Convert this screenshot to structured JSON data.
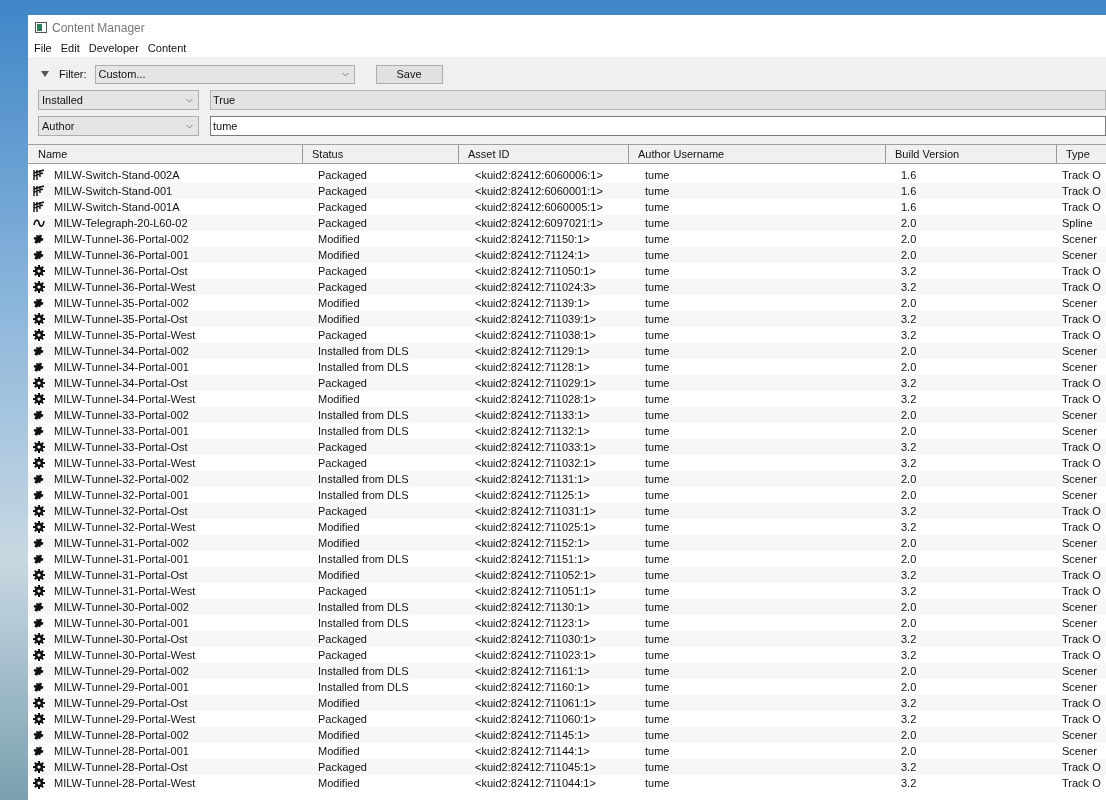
{
  "window": {
    "title": "Content Manager"
  },
  "menu": [
    "File",
    "Edit",
    "Developer",
    "Content"
  ],
  "filter": {
    "label": "Filter:",
    "preset": "Custom...",
    "save_button": "Save"
  },
  "conditions": [
    {
      "field": "Installed",
      "value": "True",
      "editable": false
    },
    {
      "field": "Author",
      "value": "tume",
      "editable": true
    }
  ],
  "table": {
    "columns": [
      "Name",
      "Status",
      "Asset ID",
      "Author Username",
      "Build Version",
      "Type"
    ],
    "rows": [
      {
        "kind": "switch",
        "name": "MILW-Switch-Stand-002A",
        "status": "Packaged",
        "asset_id": "<kuid2:82412:6060006:1>",
        "author": "tume",
        "build": "1.6",
        "type": "Track O"
      },
      {
        "kind": "switch",
        "name": "MILW-Switch-Stand-001",
        "status": "Packaged",
        "asset_id": "<kuid2:82412:6060001:1>",
        "author": "tume",
        "build": "1.6",
        "type": "Track O"
      },
      {
        "kind": "switch",
        "name": "MILW-Switch-Stand-001A",
        "status": "Packaged",
        "asset_id": "<kuid2:82412:6060005:1>",
        "author": "tume",
        "build": "1.6",
        "type": "Track O"
      },
      {
        "kind": "spline",
        "name": "MILW-Telegraph-20-L60-02",
        "status": "Packaged",
        "asset_id": "<kuid2:82412:6097021:1>",
        "author": "tume",
        "build": "2.0",
        "type": "Spline"
      },
      {
        "kind": "scenery",
        "name": "MILW-Tunnel-36-Portal-002",
        "status": "Modified",
        "asset_id": "<kuid2:82412:71150:1>",
        "author": "tume",
        "build": "2.0",
        "type": "Scener"
      },
      {
        "kind": "scenery",
        "name": "MILW-Tunnel-36-Portal-001",
        "status": "Modified",
        "asset_id": "<kuid2:82412:71124:1>",
        "author": "tume",
        "build": "2.0",
        "type": "Scener"
      },
      {
        "kind": "track",
        "name": "MILW-Tunnel-36-Portal-Ost",
        "status": "Packaged",
        "asset_id": "<kuid2:82412:711050:1>",
        "author": "tume",
        "build": "3.2",
        "type": "Track O"
      },
      {
        "kind": "track",
        "name": "MILW-Tunnel-36-Portal-West",
        "status": "Packaged",
        "asset_id": "<kuid2:82412:711024:3>",
        "author": "tume",
        "build": "3.2",
        "type": "Track O"
      },
      {
        "kind": "scenery",
        "name": "MILW-Tunnel-35-Portal-002",
        "status": "Modified",
        "asset_id": "<kuid2:82412:71139:1>",
        "author": "tume",
        "build": "2.0",
        "type": "Scener"
      },
      {
        "kind": "track",
        "name": "MILW-Tunnel-35-Portal-Ost",
        "status": "Modified",
        "asset_id": "<kuid2:82412:711039:1>",
        "author": "tume",
        "build": "3.2",
        "type": "Track O"
      },
      {
        "kind": "track",
        "name": "MILW-Tunnel-35-Portal-West",
        "status": "Packaged",
        "asset_id": "<kuid2:82412:711038:1>",
        "author": "tume",
        "build": "3.2",
        "type": "Track O"
      },
      {
        "kind": "scenery",
        "name": "MILW-Tunnel-34-Portal-002",
        "status": "Installed from DLS",
        "asset_id": "<kuid2:82412:71129:1>",
        "author": "tume",
        "build": "2.0",
        "type": "Scener"
      },
      {
        "kind": "scenery",
        "name": "MILW-Tunnel-34-Portal-001",
        "status": "Installed from DLS",
        "asset_id": "<kuid2:82412:71128:1>",
        "author": "tume",
        "build": "2.0",
        "type": "Scener"
      },
      {
        "kind": "track",
        "name": "MILW-Tunnel-34-Portal-Ost",
        "status": "Packaged",
        "asset_id": "<kuid2:82412:711029:1>",
        "author": "tume",
        "build": "3.2",
        "type": "Track O"
      },
      {
        "kind": "track",
        "name": "MILW-Tunnel-34-Portal-West",
        "status": "Modified",
        "asset_id": "<kuid2:82412:711028:1>",
        "author": "tume",
        "build": "3.2",
        "type": "Track O"
      },
      {
        "kind": "scenery",
        "name": "MILW-Tunnel-33-Portal-002",
        "status": "Installed from DLS",
        "asset_id": "<kuid2:82412:71133:1>",
        "author": "tume",
        "build": "2.0",
        "type": "Scener"
      },
      {
        "kind": "scenery",
        "name": "MILW-Tunnel-33-Portal-001",
        "status": "Installed from DLS",
        "asset_id": "<kuid2:82412:71132:1>",
        "author": "tume",
        "build": "2.0",
        "type": "Scener"
      },
      {
        "kind": "track",
        "name": "MILW-Tunnel-33-Portal-Ost",
        "status": "Packaged",
        "asset_id": "<kuid2:82412:711033:1>",
        "author": "tume",
        "build": "3.2",
        "type": "Track O"
      },
      {
        "kind": "track",
        "name": "MILW-Tunnel-33-Portal-West",
        "status": "Packaged",
        "asset_id": "<kuid2:82412:711032:1>",
        "author": "tume",
        "build": "3.2",
        "type": "Track O"
      },
      {
        "kind": "scenery",
        "name": "MILW-Tunnel-32-Portal-002",
        "status": "Installed from DLS",
        "asset_id": "<kuid2:82412:71131:1>",
        "author": "tume",
        "build": "2.0",
        "type": "Scener"
      },
      {
        "kind": "scenery",
        "name": "MILW-Tunnel-32-Portal-001",
        "status": "Installed from DLS",
        "asset_id": "<kuid2:82412:71125:1>",
        "author": "tume",
        "build": "2.0",
        "type": "Scener"
      },
      {
        "kind": "track",
        "name": "MILW-Tunnel-32-Portal-Ost",
        "status": "Packaged",
        "asset_id": "<kuid2:82412:711031:1>",
        "author": "tume",
        "build": "3.2",
        "type": "Track O"
      },
      {
        "kind": "track",
        "name": "MILW-Tunnel-32-Portal-West",
        "status": "Modified",
        "asset_id": "<kuid2:82412:711025:1>",
        "author": "tume",
        "build": "3.2",
        "type": "Track O"
      },
      {
        "kind": "scenery",
        "name": "MILW-Tunnel-31-Portal-002",
        "status": "Modified",
        "asset_id": "<kuid2:82412:71152:1>",
        "author": "tume",
        "build": "2.0",
        "type": "Scener"
      },
      {
        "kind": "scenery",
        "name": "MILW-Tunnel-31-Portal-001",
        "status": "Installed from DLS",
        "asset_id": "<kuid2:82412:71151:1>",
        "author": "tume",
        "build": "2.0",
        "type": "Scener"
      },
      {
        "kind": "track",
        "name": "MILW-Tunnel-31-Portal-Ost",
        "status": "Modified",
        "asset_id": "<kuid2:82412:711052:1>",
        "author": "tume",
        "build": "3.2",
        "type": "Track O"
      },
      {
        "kind": "track",
        "name": "MILW-Tunnel-31-Portal-West",
        "status": "Packaged",
        "asset_id": "<kuid2:82412:711051:1>",
        "author": "tume",
        "build": "3.2",
        "type": "Track O"
      },
      {
        "kind": "scenery",
        "name": "MILW-Tunnel-30-Portal-002",
        "status": "Installed from DLS",
        "asset_id": "<kuid2:82412:71130:1>",
        "author": "tume",
        "build": "2.0",
        "type": "Scener"
      },
      {
        "kind": "scenery",
        "name": "MILW-Tunnel-30-Portal-001",
        "status": "Installed from DLS",
        "asset_id": "<kuid2:82412:71123:1>",
        "author": "tume",
        "build": "2.0",
        "type": "Scener"
      },
      {
        "kind": "track",
        "name": "MILW-Tunnel-30-Portal-Ost",
        "status": "Packaged",
        "asset_id": "<kuid2:82412:711030:1>",
        "author": "tume",
        "build": "3.2",
        "type": "Track O"
      },
      {
        "kind": "track",
        "name": "MILW-Tunnel-30-Portal-West",
        "status": "Packaged",
        "asset_id": "<kuid2:82412:711023:1>",
        "author": "tume",
        "build": "3.2",
        "type": "Track O"
      },
      {
        "kind": "scenery",
        "name": "MILW-Tunnel-29-Portal-002",
        "status": "Installed from DLS",
        "asset_id": "<kuid2:82412:71161:1>",
        "author": "tume",
        "build": "2.0",
        "type": "Scener"
      },
      {
        "kind": "scenery",
        "name": "MILW-Tunnel-29-Portal-001",
        "status": "Installed from DLS",
        "asset_id": "<kuid2:82412:71160:1>",
        "author": "tume",
        "build": "2.0",
        "type": "Scener"
      },
      {
        "kind": "track",
        "name": "MILW-Tunnel-29-Portal-Ost",
        "status": "Modified",
        "asset_id": "<kuid2:82412:711061:1>",
        "author": "tume",
        "build": "3.2",
        "type": "Track O"
      },
      {
        "kind": "track",
        "name": "MILW-Tunnel-29-Portal-West",
        "status": "Packaged",
        "asset_id": "<kuid2:82412:711060:1>",
        "author": "tume",
        "build": "3.2",
        "type": "Track O"
      },
      {
        "kind": "scenery",
        "name": "MILW-Tunnel-28-Portal-002",
        "status": "Modified",
        "asset_id": "<kuid2:82412:71145:1>",
        "author": "tume",
        "build": "2.0",
        "type": "Scener"
      },
      {
        "kind": "scenery",
        "name": "MILW-Tunnel-28-Portal-001",
        "status": "Modified",
        "asset_id": "<kuid2:82412:71144:1>",
        "author": "tume",
        "build": "2.0",
        "type": "Scener"
      },
      {
        "kind": "track",
        "name": "MILW-Tunnel-28-Portal-Ost",
        "status": "Packaged",
        "asset_id": "<kuid2:82412:711045:1>",
        "author": "tume",
        "build": "3.2",
        "type": "Track O"
      },
      {
        "kind": "track",
        "name": "MILW-Tunnel-28-Portal-West",
        "status": "Modified",
        "asset_id": "<kuid2:82412:711044:1>",
        "author": "tume",
        "build": "3.2",
        "type": "Track O"
      }
    ]
  }
}
